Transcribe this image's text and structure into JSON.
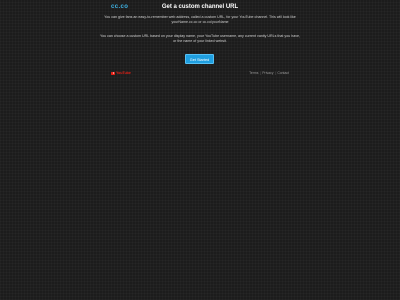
{
  "header": {
    "logo_text": "cc.co",
    "title": "Get a custom channel URL"
  },
  "intro": {
    "paragraph1": "You can give fans an easy-to-remember web address, called a custom URL, for your YouTube channel. This will look like yourName.cc.co or cc.co/yourName",
    "paragraph2": "You can choose a custom URL based on your display name, your YouTube username, any current vanity URLs that you have, or the name of your linked websit."
  },
  "cta": {
    "label": "Get Started"
  },
  "footer": {
    "brand": "YouTube",
    "links": [
      "Terms",
      "Privacy",
      "Contact"
    ],
    "separator": "|"
  },
  "colors": {
    "accent": "#1f9fe0",
    "logo": "#3fb6e8",
    "brand_red": "#e62117",
    "background": "#1c1c1c"
  }
}
